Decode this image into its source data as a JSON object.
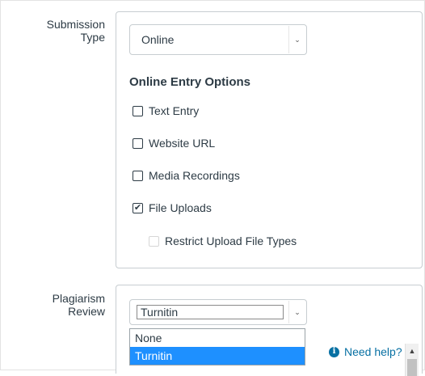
{
  "submission": {
    "label": "Submission Type",
    "selected": "Online",
    "options_title": "Online Entry Options",
    "options": [
      {
        "label": "Text Entry",
        "checked": false
      },
      {
        "label": "Website URL",
        "checked": false
      },
      {
        "label": "Media Recordings",
        "checked": false
      },
      {
        "label": "File Uploads",
        "checked": true
      }
    ],
    "sub_option": {
      "label": "Restrict Upload File Types",
      "checked": false,
      "disabled": true
    }
  },
  "plagiarism": {
    "label": "Plagiarism Review",
    "selected": "Turnitin",
    "dropdown": [
      {
        "label": "None",
        "selected": false
      },
      {
        "label": "Turnitin",
        "selected": true
      }
    ],
    "help": "Need help?"
  },
  "colors": {
    "accent": "#0770a3",
    "selection": "#1e90ff",
    "text": "#2d3b45",
    "border": "#c7cdd1"
  },
  "icons": {
    "chevron": "chevron-down-icon",
    "check": "check-icon",
    "info": "info-icon",
    "scroll_up": "scroll-up-arrow-icon"
  }
}
